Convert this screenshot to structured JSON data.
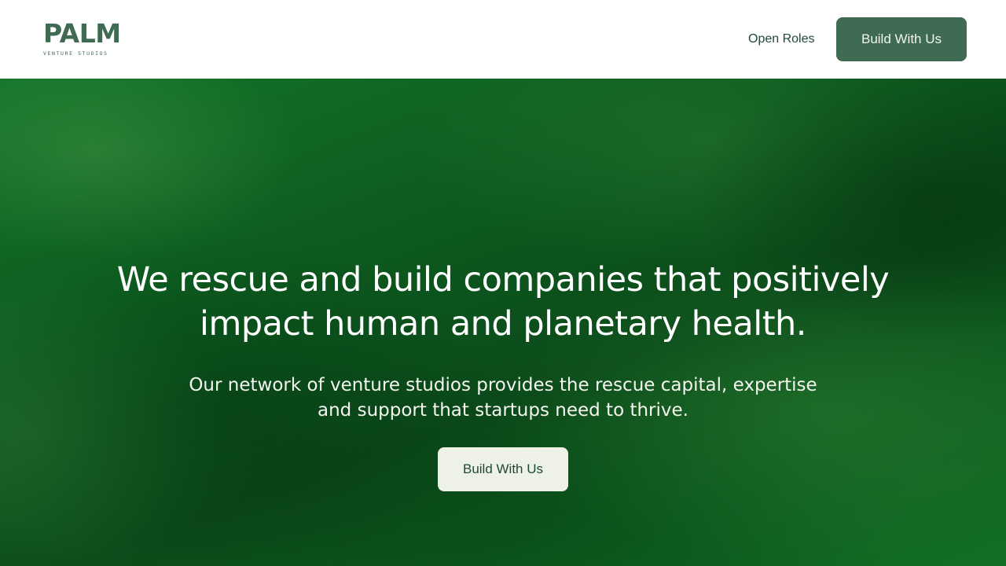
{
  "header": {
    "logo": {
      "wordmark": "PALM",
      "tagline": "VENTURE STUDIOS"
    },
    "nav": {
      "open_roles": "Open Roles",
      "cta": "Build With Us"
    }
  },
  "hero": {
    "title": "We rescue and build companies that positively impact human and planetary health.",
    "subtitle": "Our network of venture studios provides the rescue capital, expertise and support that startups need to thrive.",
    "cta": "Build With Us"
  },
  "colors": {
    "brand_green": "#3f6b52",
    "hero_green": "#0e5520",
    "cta_light": "#eef1e6",
    "text_dark_green": "#1f4a36"
  }
}
